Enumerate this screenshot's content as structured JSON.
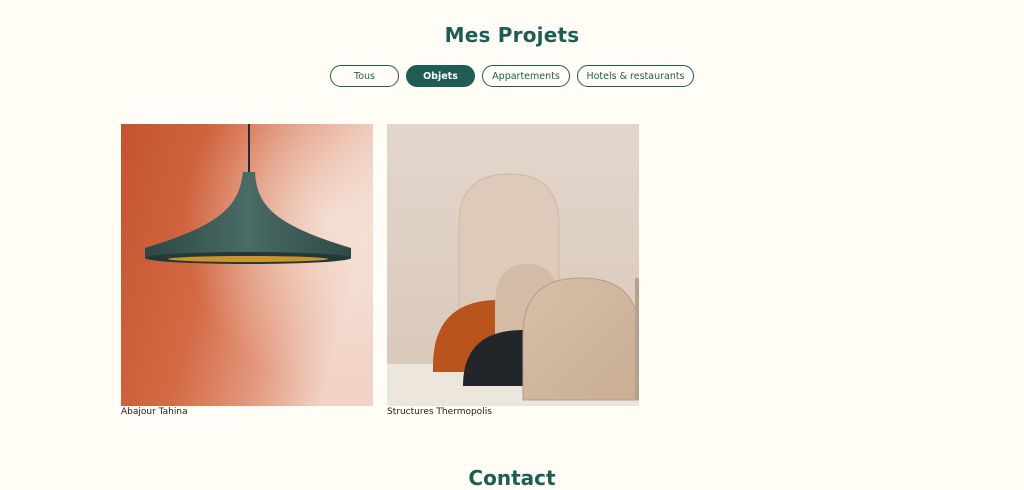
{
  "projects": {
    "title": "Mes Projets",
    "filters": [
      {
        "label": "Tous",
        "active": false
      },
      {
        "label": "Objets",
        "active": true
      },
      {
        "label": "Appartements",
        "active": false
      },
      {
        "label": "Hotels & restaurants",
        "active": false
      }
    ],
    "items": [
      {
        "caption": "Abajour Tahina",
        "image": "pendant-lamp-orange-wall"
      },
      {
        "caption": "Structures Thermopolis",
        "image": "arch-structures-beige"
      }
    ]
  },
  "contact": {
    "title": "Contact"
  },
  "colors": {
    "accent": "#1e5e52",
    "background": "#fffdf6"
  }
}
